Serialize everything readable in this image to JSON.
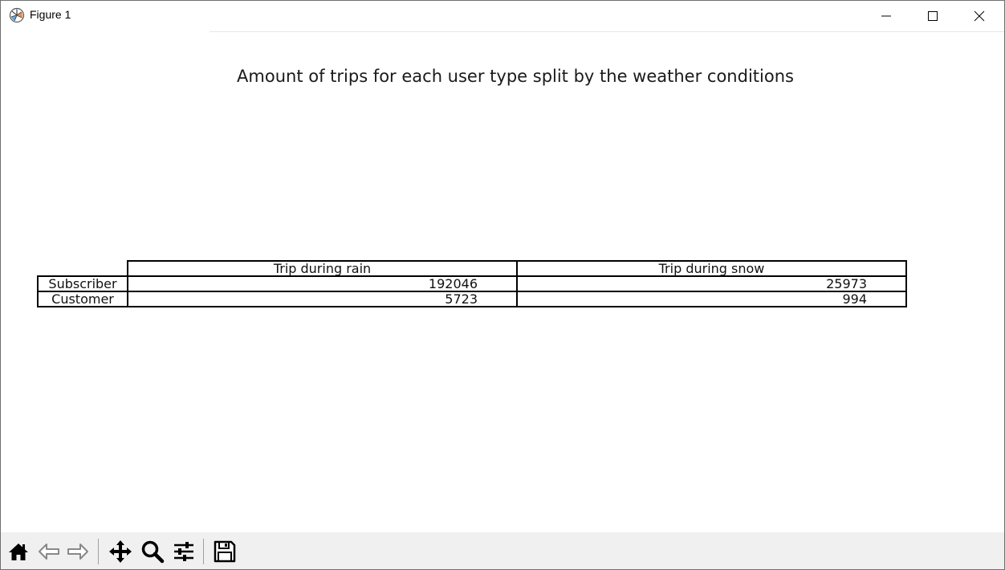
{
  "window": {
    "title": "Figure 1"
  },
  "figure": {
    "title": "Amount of trips for each user type split by the weather conditions"
  },
  "chart_data": {
    "type": "table",
    "title": "Amount of trips for each user type split by the weather conditions",
    "columns": [
      "Trip during rain",
      "Trip during snow"
    ],
    "rows": [
      {
        "label": "Subscriber",
        "values": [
          "192046",
          "25973"
        ]
      },
      {
        "label": "Customer",
        "values": [
          "5723",
          "994"
        ]
      }
    ]
  },
  "toolbar": {
    "icons": [
      "home-icon",
      "back-arrow-icon",
      "forward-arrow-icon",
      "pan-icon",
      "zoom-icon",
      "configure-subplots-icon",
      "save-icon"
    ]
  }
}
